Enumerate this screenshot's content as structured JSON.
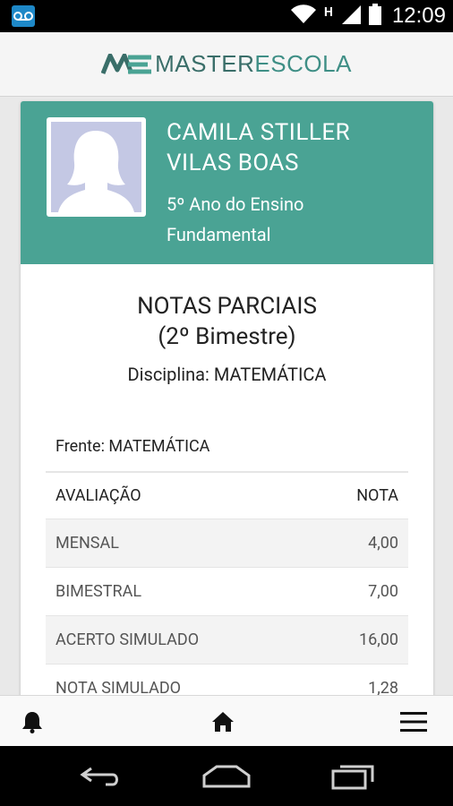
{
  "status_bar": {
    "time": "12:09",
    "network_label": "H",
    "icons": [
      "voicemail-icon",
      "wifi-icon",
      "signal-icon",
      "battery-icon"
    ]
  },
  "app": {
    "logo_prefix": "MASTER",
    "logo_suffix": "ESCOLA"
  },
  "student": {
    "name": "CAMILA STILLER VILAS BOAS",
    "class": "5º Ano do Ensino Fundamental"
  },
  "report": {
    "title": "NOTAS PARCIAIS",
    "period": "(2º Bimestre)",
    "discipline": "Disciplina: MATEMÁTICA",
    "frente": "Frente: MATEMÁTICA",
    "columns": {
      "evaluation": "AVALIAÇÃO",
      "grade": "NOTA"
    },
    "rows": [
      {
        "evaluation": "MENSAL",
        "grade": "4,00"
      },
      {
        "evaluation": "BIMESTRAL",
        "grade": "7,00"
      },
      {
        "evaluation": "ACERTO SIMULADO",
        "grade": "16,00"
      },
      {
        "evaluation": "NOTA SIMULADO",
        "grade": "1,28"
      }
    ]
  },
  "bottom_nav": [
    "bell-icon",
    "home-icon",
    "menu-icon"
  ],
  "colors": {
    "header_green": "#4aa394",
    "logo_green": "#3f8f86"
  }
}
